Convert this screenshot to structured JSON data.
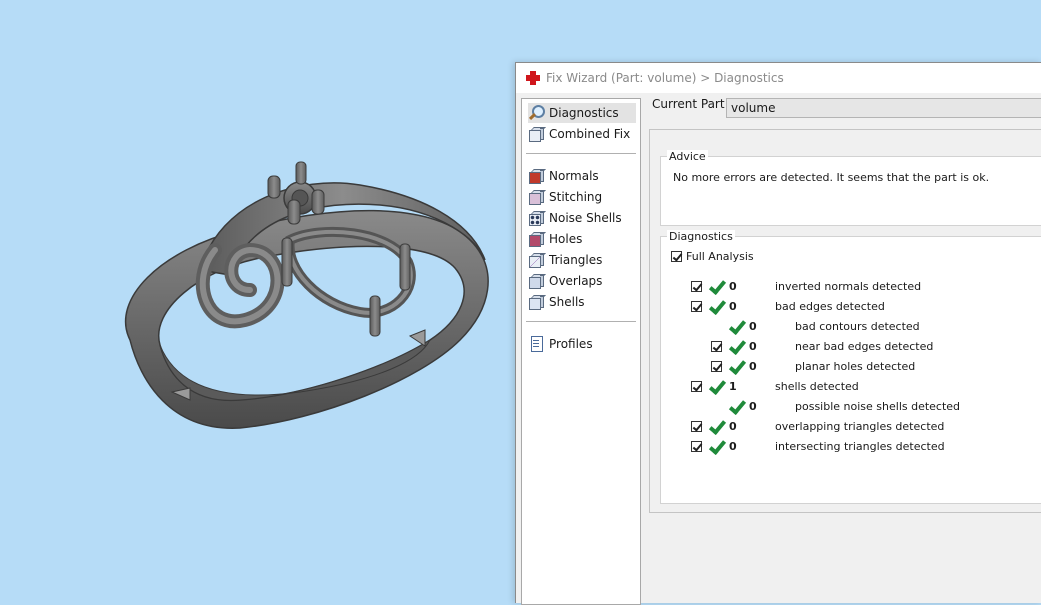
{
  "window": {
    "title": "Fix Wizard (Part: volume) > Diagnostics"
  },
  "nav": {
    "top_items": [
      {
        "label": "Diagnostics",
        "icon": "magnifier-icon"
      },
      {
        "label": "Combined Fix",
        "icon": "cube-icon"
      }
    ],
    "fix_items": [
      {
        "label": "Normals",
        "icon": "normals-icon"
      },
      {
        "label": "Stitching",
        "icon": "stitching-icon"
      },
      {
        "label": "Noise Shells",
        "icon": "noise-shells-icon"
      },
      {
        "label": "Holes",
        "icon": "holes-icon"
      },
      {
        "label": "Triangles",
        "icon": "triangles-icon"
      },
      {
        "label": "Overlaps",
        "icon": "overlaps-icon"
      },
      {
        "label": "Shells",
        "icon": "shells-icon"
      }
    ],
    "bottom_items": [
      {
        "label": "Profiles",
        "icon": "profiles-icon"
      }
    ]
  },
  "current_part": {
    "label": "Current Part:",
    "value": "volume"
  },
  "advice": {
    "title": "Advice",
    "text": "No more errors are detected. It seems that the part is ok."
  },
  "diagnostics": {
    "title": "Diagnostics",
    "full_analysis_label": "Full Analysis",
    "rows": [
      {
        "count": "0",
        "label": "inverted normals detected"
      },
      {
        "count": "0",
        "label": "bad edges detected"
      },
      {
        "count": "0",
        "label": "bad contours detected"
      },
      {
        "count": "0",
        "label": "near bad edges detected"
      },
      {
        "count": "0",
        "label": "planar holes detected"
      },
      {
        "count": "1",
        "label": "shells detected"
      },
      {
        "count": "0",
        "label": "possible noise shells detected"
      },
      {
        "count": "0",
        "label": "overlapping triangles detected"
      },
      {
        "count": "0",
        "label": "intersecting triangles detected"
      }
    ]
  },
  "colors": {
    "viewport_bg": "#b6dcf7",
    "model": "#6e6e6e",
    "ok_check": "#1f8a3a"
  }
}
